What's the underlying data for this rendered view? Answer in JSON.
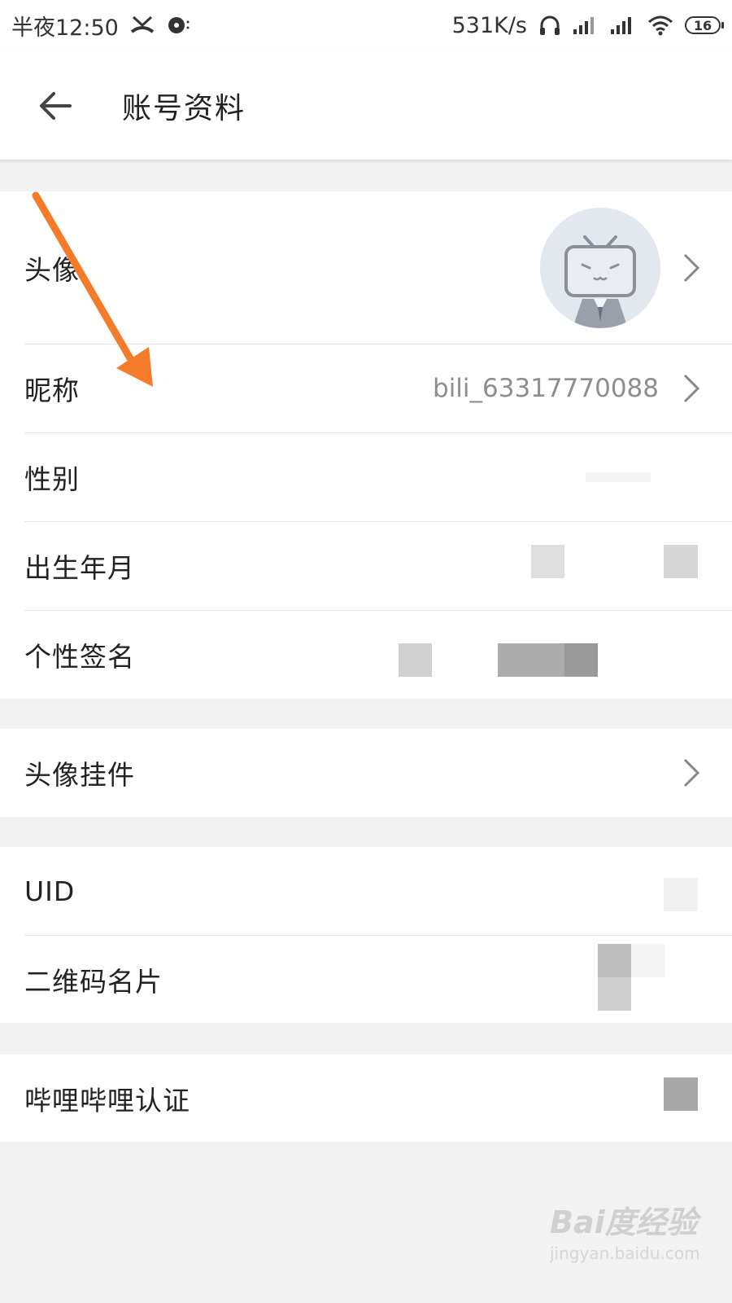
{
  "status_bar": {
    "time": "半夜12:50",
    "speed": "531K/s",
    "battery": "16"
  },
  "header": {
    "title": "账号资料"
  },
  "profile": {
    "avatar_label": "头像",
    "nickname_label": "昵称",
    "nickname_value": "bili_63317770088",
    "gender_label": "性别",
    "birthday_label": "出生年月",
    "signature_label": "个性签名"
  },
  "pendant": {
    "label": "头像挂件"
  },
  "ids": {
    "uid_label": "UID",
    "qrcode_label": "二维码名片"
  },
  "verify": {
    "label": "哔哩哔哩认证"
  },
  "watermark": {
    "logo": "Bai度经验",
    "url": "jingyan.baidu.com"
  },
  "colors": {
    "annotation_arrow": "#f47b2a",
    "background": "#f2f2f2",
    "value_gray": "#8e8e8e"
  }
}
